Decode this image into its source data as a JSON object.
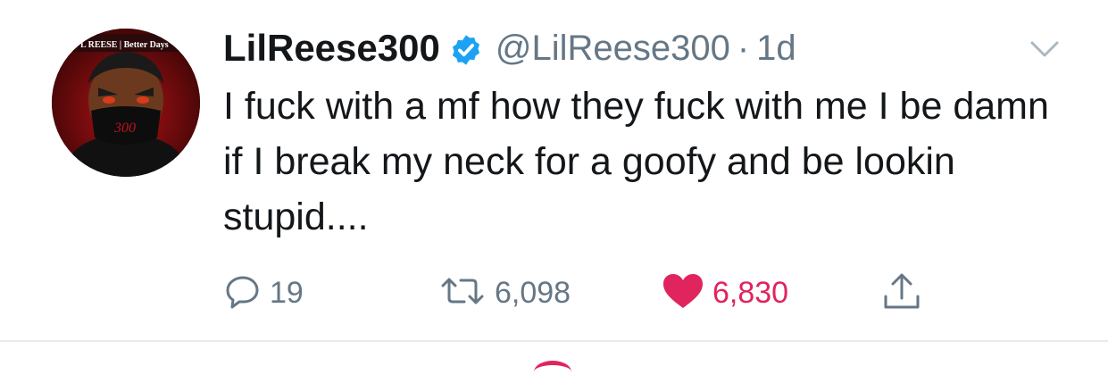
{
  "tweet": {
    "display_name": "LilReese300",
    "handle": "@LilReese300",
    "separator": "·",
    "time": "1d",
    "text": "I fuck with a mf how they fuck with me I be damn if I break my neck for a goofy and be lookin stupid....",
    "avatar_banner_text": "L REESE | Better Days",
    "avatar_mask_text": "300"
  },
  "actions": {
    "reply_count": "19",
    "retweet_count": "6,098",
    "like_count": "6,830"
  },
  "colors": {
    "verified": "#1da1f2",
    "like": "#e0245e",
    "secondary_text": "#657786"
  },
  "icons": {
    "verified": "verified-badge-icon",
    "menu": "chevron-down-icon",
    "reply": "reply-icon",
    "retweet": "retweet-icon",
    "like": "heart-icon",
    "share": "share-icon"
  }
}
